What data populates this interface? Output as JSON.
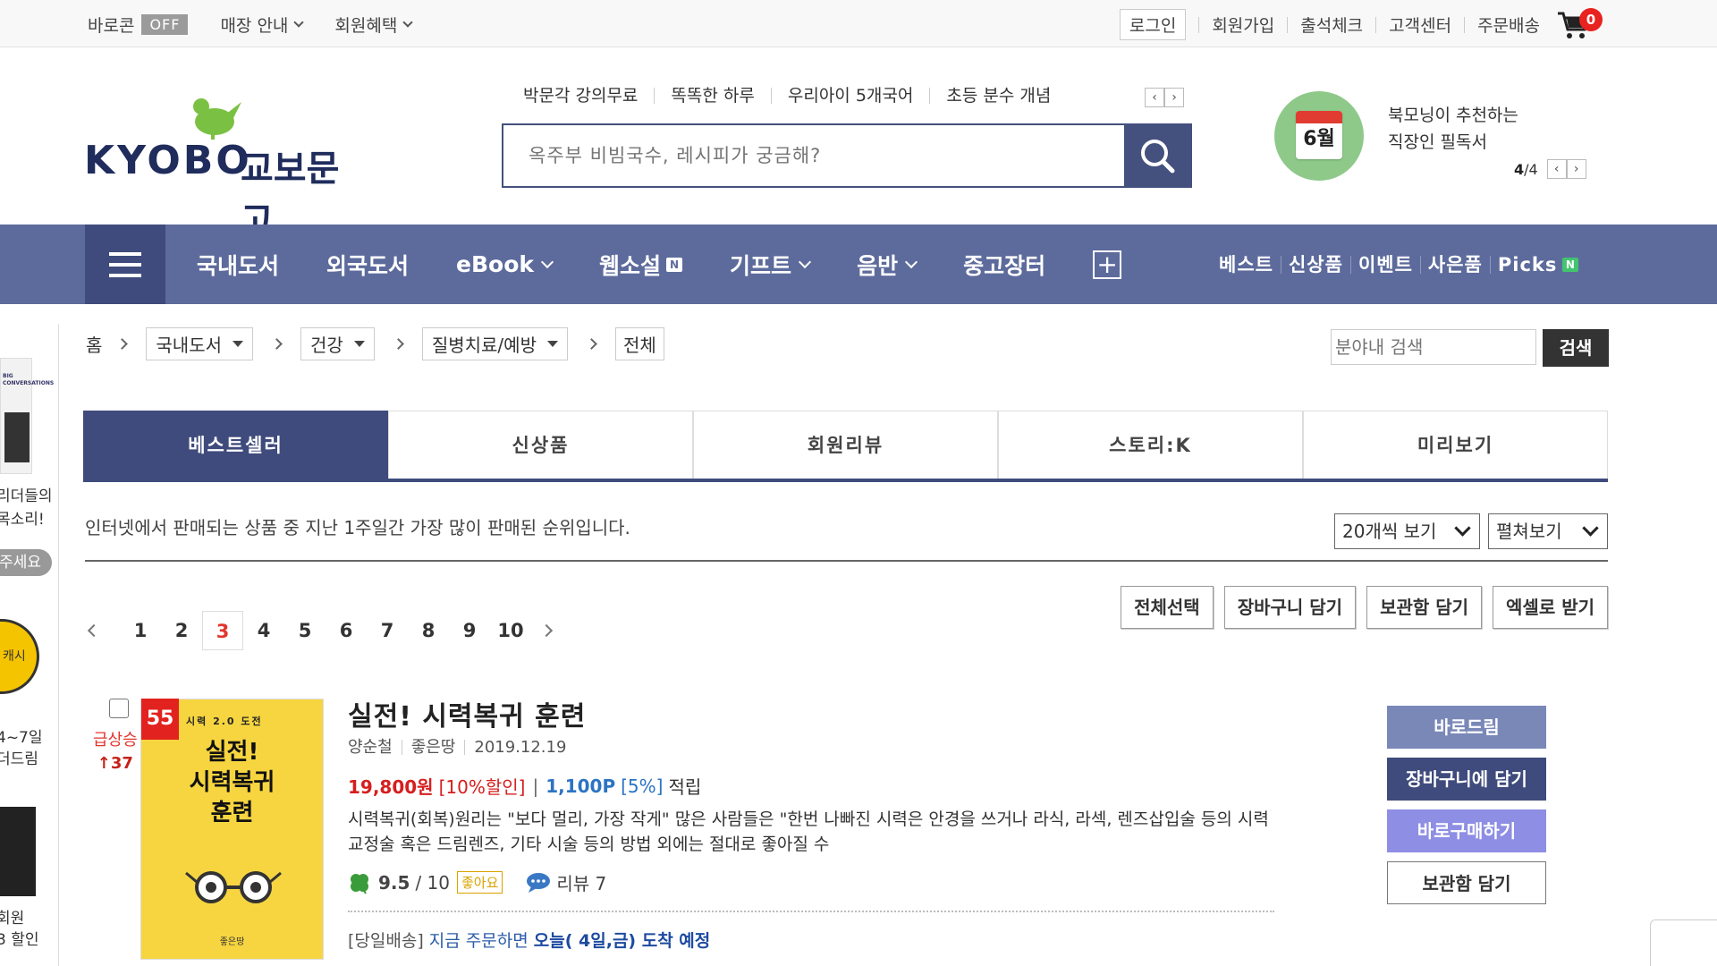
{
  "topbar": {
    "baro_label": "바로콘",
    "baro_status": "OFF",
    "store_info": "매장 안내",
    "member_benefits": "회원혜택",
    "login": "로그인",
    "signup": "회원가입",
    "attendance": "출석체크",
    "customer_center": "고객센터",
    "order_delivery": "주문배송",
    "cart_count": "0"
  },
  "logo": {
    "en": "KYOBO",
    "kr": "교보문고"
  },
  "quicklinks": [
    "박문각 강의무료",
    "똑똑한 하루",
    "우리아이 5개국어",
    "초등 분수 개념"
  ],
  "search": {
    "placeholder": "옥주부 비빔국수, 레시피가 궁금해?"
  },
  "promo": {
    "month": "6월",
    "line1": "북모닝이 추천하는",
    "line2": "직장인 필독서",
    "page_current": "4",
    "page_total": "/4"
  },
  "nav": {
    "items": [
      "국내도서",
      "외국도서",
      "eBook",
      "웹소설",
      "기프트",
      "음반",
      "중고장터"
    ],
    "sub": [
      "베스트",
      "신상품",
      "이벤트",
      "사은품",
      "Picks"
    ],
    "badge_n": "N"
  },
  "sidebar": {
    "text1": "리더들의",
    "text2": "목소리!",
    "btn": "주세요",
    "coin": "캐시",
    "text3": "4~7일",
    "text4": "더드림",
    "text5": "회원",
    "text6": "3 할인",
    "book_text": "BIG CONVERSATIONS"
  },
  "breadcrumb": {
    "home": "홈",
    "level1": "국내도서",
    "level2": "건강",
    "level3": "질병치료/예방",
    "level4": "전체"
  },
  "cat_search": {
    "placeholder": "분야내 검색",
    "button": "검색"
  },
  "tabs": [
    "베스트셀러",
    "신상품",
    "회원리뷰",
    "스토리:K",
    "미리보기"
  ],
  "list_desc": "인터넷에서 판매되는 상품 중 지난 1주일간 가장 많이 판매된 순위입니다.",
  "view_count": "20개씩 보기",
  "view_mode": "펼쳐보기",
  "actions": [
    "전체선택",
    "장바구니 담기",
    "보관함 담기",
    "엑셀로 받기"
  ],
  "pagination": {
    "pages": [
      "1",
      "2",
      "3",
      "4",
      "5",
      "6",
      "7",
      "8",
      "9",
      "10"
    ],
    "current": "3"
  },
  "product": {
    "rank": "55",
    "rank_label": "급상승",
    "rank_change": "↑37",
    "cover_series": "시력 2.0 도전",
    "cover_title_line1": "실전!",
    "cover_title_line2": "시력복귀",
    "cover_title_line3": "훈련",
    "cover_publisher": "좋은땅",
    "title": "실전! 시력복귀 훈련",
    "author": "양순철",
    "publisher": "좋은땅",
    "date": "2019.12.19",
    "price": "19,800원",
    "discount": "[10%할인]",
    "pipe": "|",
    "point": "1,100P",
    "point_rate": "[5%]",
    "point_label": "적립",
    "description": "시력복귀(회복)원리는 \"보다 멀리, 가장 작게\" 많은 사람들은 \"한번 나빠진 시력은 안경을 쓰거나 라식, 라섹, 렌즈삽입술 등의 시력교정술 혹은 드림렌즈, 기타 시술 등의 방법 외에는 절대로 좋아질 수",
    "score": "9.5",
    "score_total": "/ 10",
    "good_badge": "좋아요",
    "review_label": "리뷰 7",
    "ship_tag": "[당일배송]",
    "ship_text": "지금 주문하면",
    "ship_date": "오늘( 4일,금) 도착 예정",
    "buttons": [
      "바로드림",
      "장바구니에 담기",
      "바로구매하기",
      "보관함 담기"
    ]
  },
  "colors": {
    "nav_bg": "#5d6b9c",
    "nav_dark": "#3f4b7c",
    "price_red": "#d61e1e",
    "point_blue": "#2b73c4"
  }
}
